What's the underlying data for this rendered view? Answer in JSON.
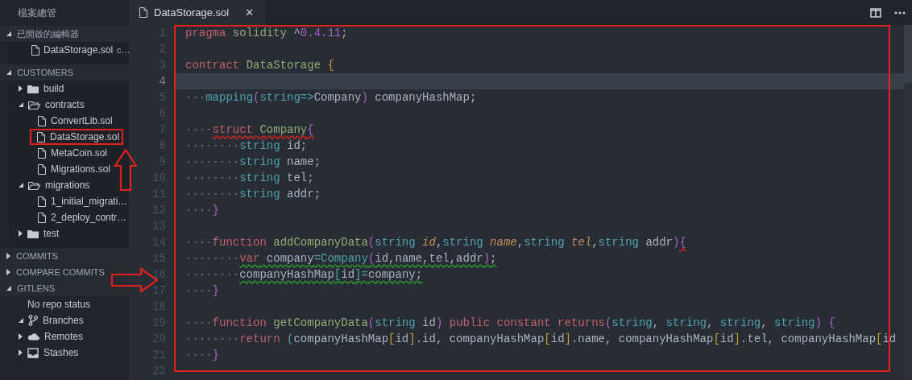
{
  "sidebar": {
    "title": "檔案總管",
    "sections": [
      {
        "title": "已開啟的編輯器",
        "expanded": true,
        "items": [
          {
            "kind": "file",
            "label": "DataStorage.sol",
            "description": "c…"
          }
        ]
      },
      {
        "title": "CUSTOMERS",
        "expanded": true,
        "items": [
          {
            "kind": "folder",
            "label": "build",
            "expanded": false
          },
          {
            "kind": "folder",
            "label": "contracts",
            "expanded": true,
            "children": [
              {
                "kind": "file",
                "label": "ConvertLib.sol"
              },
              {
                "kind": "file",
                "label": "DataStorage.sol",
                "outlined": true
              },
              {
                "kind": "file",
                "label": "MetaCoin.sol"
              },
              {
                "kind": "file",
                "label": "Migrations.sol"
              }
            ]
          },
          {
            "kind": "folder",
            "label": "migrations",
            "expanded": true,
            "children": [
              {
                "kind": "file",
                "label": "1_initial_migrati…"
              },
              {
                "kind": "file",
                "label": "2_deploy_contr…"
              }
            ]
          },
          {
            "kind": "folder",
            "label": "test",
            "expanded": false
          }
        ]
      },
      {
        "title": "COMMITS",
        "expanded": false
      },
      {
        "title": "COMPARE COMMITS",
        "expanded": false
      },
      {
        "title": "GITLENS",
        "expanded": true,
        "items": [
          {
            "kind": "message",
            "label": "No repo status"
          },
          {
            "kind": "branches",
            "label": "Branches",
            "expanded": true
          },
          {
            "kind": "remotes",
            "label": "Remotes",
            "expanded": false
          },
          {
            "kind": "stashes",
            "label": "Stashes",
            "expanded": false
          }
        ]
      }
    ]
  },
  "editor": {
    "tabs": [
      {
        "label": "DataStorage.sol",
        "selected": true,
        "close": "✕"
      }
    ],
    "outlined": true,
    "lines": [
      {
        "number": "1",
        "current": false,
        "tokens": [
          {
            "kind": "keyword",
            "text": "pragma "
          },
          {
            "kind": "name",
            "text": "solidity "
          },
          {
            "kind": "plain",
            "text": "^"
          },
          {
            "kind": "number",
            "text": "0.4.11"
          },
          {
            "kind": "plain",
            "text": ";"
          }
        ]
      },
      {
        "number": "2",
        "current": false
      },
      {
        "number": "3",
        "current": false,
        "tokens": [
          {
            "kind": "keyword",
            "text": "contract "
          },
          {
            "kind": "name",
            "text": "DataStorage "
          },
          {
            "kind": "bracket",
            "text": "{"
          }
        ]
      },
      {
        "number": "4",
        "current": true
      },
      {
        "number": "5",
        "current": false,
        "tokens": [
          {
            "kind": "space",
            "text": "···"
          },
          {
            "kind": "type",
            "text": "mapping"
          },
          {
            "kind": "paren",
            "text": "("
          },
          {
            "kind": "type",
            "text": "string=>"
          },
          {
            "kind": "plain",
            "text": "Company"
          },
          {
            "kind": "paren",
            "text": ")"
          },
          {
            "kind": "plain",
            "text": " companyHashMap;"
          }
        ]
      },
      {
        "number": "6",
        "current": false
      },
      {
        "number": "7",
        "current": false,
        "tokens": [
          {
            "kind": "space",
            "text": "····"
          },
          {
            "kind": "keyword",
            "text": "struct ",
            "error": true
          },
          {
            "kind": "name",
            "text": "Company",
            "error": true
          },
          {
            "kind": "paren",
            "text": "{",
            "error": true
          }
        ]
      },
      {
        "number": "8",
        "current": false,
        "tokens": [
          {
            "kind": "space",
            "text": "········"
          },
          {
            "kind": "type",
            "text": "string"
          },
          {
            "kind": "plain",
            "text": " id;"
          }
        ]
      },
      {
        "number": "9",
        "current": false,
        "tokens": [
          {
            "kind": "space",
            "text": "········"
          },
          {
            "kind": "type",
            "text": "string"
          },
          {
            "kind": "plain",
            "text": " name;"
          }
        ]
      },
      {
        "number": "10",
        "current": false,
        "tokens": [
          {
            "kind": "space",
            "text": "········"
          },
          {
            "kind": "type",
            "text": "string"
          },
          {
            "kind": "plain",
            "text": " tel;"
          }
        ]
      },
      {
        "number": "11",
        "current": false,
        "tokens": [
          {
            "kind": "space",
            "text": "········"
          },
          {
            "kind": "type",
            "text": "string"
          },
          {
            "kind": "plain",
            "text": " addr;"
          }
        ]
      },
      {
        "number": "12",
        "current": false,
        "tokens": [
          {
            "kind": "space",
            "text": "····"
          },
          {
            "kind": "paren",
            "text": "}"
          }
        ]
      },
      {
        "number": "13",
        "current": false
      },
      {
        "number": "14",
        "current": false,
        "tokens": [
          {
            "kind": "space",
            "text": "····"
          },
          {
            "kind": "keyword",
            "text": "function "
          },
          {
            "kind": "name",
            "text": "addCompanyData"
          },
          {
            "kind": "paren",
            "text": "("
          },
          {
            "kind": "type",
            "text": "string "
          },
          {
            "kind": "param",
            "text": "id"
          },
          {
            "kind": "plain",
            "text": ","
          },
          {
            "kind": "type",
            "text": "string "
          },
          {
            "kind": "param",
            "text": "name"
          },
          {
            "kind": "plain",
            "text": ","
          },
          {
            "kind": "type",
            "text": "string "
          },
          {
            "kind": "param",
            "text": "tel"
          },
          {
            "kind": "plain",
            "text": ","
          },
          {
            "kind": "type",
            "text": "string "
          },
          {
            "kind": "plain",
            "text": "addr"
          },
          {
            "kind": "paren",
            "text": ")"
          },
          {
            "kind": "paren",
            "text": "{",
            "error": true
          }
        ]
      },
      {
        "number": "15",
        "current": false,
        "tokens": [
          {
            "kind": "space",
            "text": "········"
          },
          {
            "kind": "keyword",
            "text": "var",
            "warning": true
          },
          {
            "kind": "plain",
            "text": " company",
            "warning": true
          },
          {
            "kind": "type",
            "text": "=Company",
            "warning": true
          },
          {
            "kind": "paren",
            "text": "(",
            "warning": true
          },
          {
            "kind": "plain",
            "text": "id,name,tel,addr",
            "warning": true
          },
          {
            "kind": "paren",
            "text": ")",
            "warning": true
          },
          {
            "kind": "plain",
            "text": ";",
            "warning": true
          }
        ]
      },
      {
        "number": "16",
        "current": false,
        "tokens": [
          {
            "kind": "space",
            "text": "········"
          },
          {
            "kind": "plain",
            "text": "companyHashMap",
            "warning": true
          },
          {
            "kind": "type",
            "text": "[",
            "warning": true
          },
          {
            "kind": "plain",
            "text": "id",
            "warning": true
          },
          {
            "kind": "type",
            "text": "]=",
            "warning": true
          },
          {
            "kind": "plain",
            "text": "company;",
            "warning": true
          }
        ]
      },
      {
        "number": "17",
        "current": false,
        "tokens": [
          {
            "kind": "space",
            "text": "····"
          },
          {
            "kind": "paren",
            "text": "}"
          }
        ]
      },
      {
        "number": "18",
        "current": false
      },
      {
        "number": "19",
        "current": false,
        "tokens": [
          {
            "kind": "space",
            "text": "····"
          },
          {
            "kind": "keyword",
            "text": "function "
          },
          {
            "kind": "name",
            "text": "getCompanyData"
          },
          {
            "kind": "paren",
            "text": "("
          },
          {
            "kind": "type",
            "text": "string "
          },
          {
            "kind": "plain",
            "text": "id"
          },
          {
            "kind": "paren",
            "text": ")"
          },
          {
            "kind": "keyword",
            "text": " public constant returns"
          },
          {
            "kind": "paren",
            "text": "("
          },
          {
            "kind": "type",
            "text": "string"
          },
          {
            "kind": "plain",
            "text": ", "
          },
          {
            "kind": "type",
            "text": "string"
          },
          {
            "kind": "plain",
            "text": ", "
          },
          {
            "kind": "type",
            "text": "string"
          },
          {
            "kind": "plain",
            "text": ", "
          },
          {
            "kind": "type",
            "text": "string"
          },
          {
            "kind": "paren",
            "text": ")"
          },
          {
            "kind": "paren",
            "text": " {"
          }
        ]
      },
      {
        "number": "20",
        "current": false,
        "tokens": [
          {
            "kind": "space",
            "text": "········"
          },
          {
            "kind": "keyword",
            "text": "return "
          },
          {
            "kind": "type",
            "text": "("
          },
          {
            "kind": "plain",
            "text": "companyHashMap"
          },
          {
            "kind": "bracket",
            "text": "["
          },
          {
            "kind": "plain",
            "text": "id"
          },
          {
            "kind": "bracket",
            "text": "]"
          },
          {
            "kind": "plain",
            "text": ".id, companyHashMap"
          },
          {
            "kind": "bracket",
            "text": "["
          },
          {
            "kind": "plain",
            "text": "id"
          },
          {
            "kind": "bracket",
            "text": "]"
          },
          {
            "kind": "plain",
            "text": ".name, companyHashMap"
          },
          {
            "kind": "bracket",
            "text": "["
          },
          {
            "kind": "plain",
            "text": "id"
          },
          {
            "kind": "bracket",
            "text": "]"
          },
          {
            "kind": "plain",
            "text": ".tel, companyHashMap"
          },
          {
            "kind": "bracket",
            "text": "["
          },
          {
            "kind": "plain",
            "text": "id"
          }
        ]
      },
      {
        "number": "21",
        "current": false,
        "tokens": [
          {
            "kind": "space",
            "text": "····"
          },
          {
            "kind": "paren",
            "text": "}"
          }
        ]
      },
      {
        "number": "22",
        "current": false
      }
    ]
  },
  "annotations": {
    "up_arrow": true,
    "right_arrow": true
  }
}
